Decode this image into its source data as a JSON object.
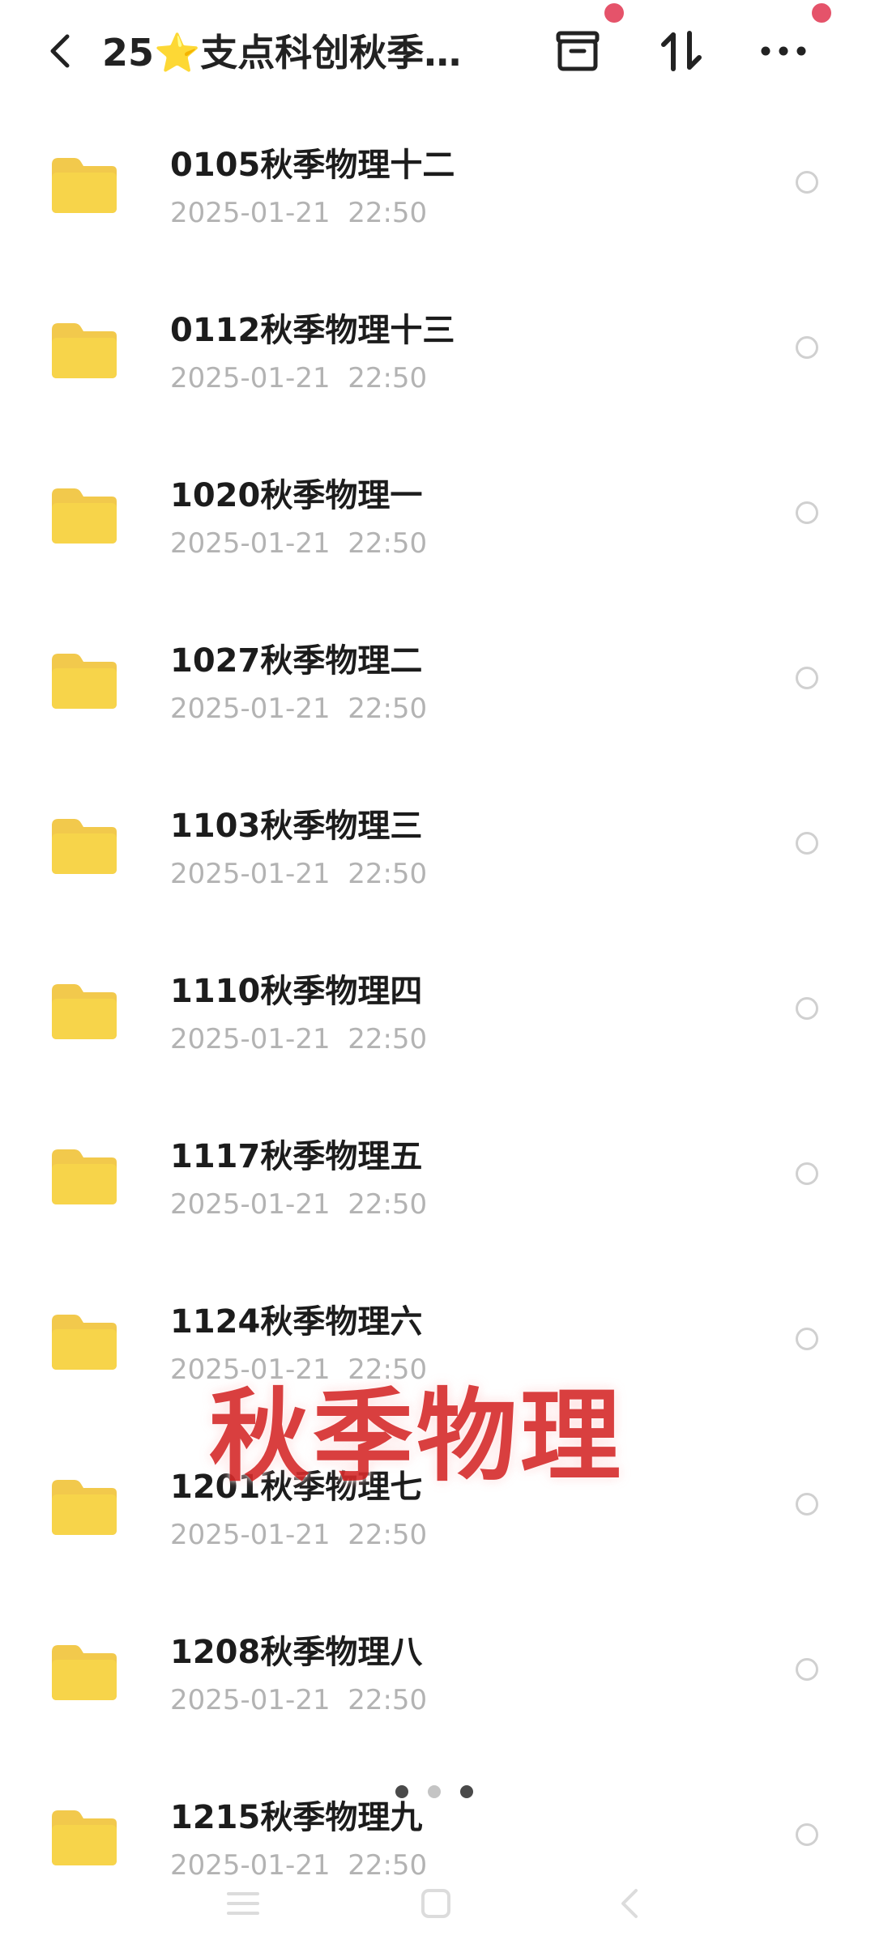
{
  "header": {
    "title": "25⭐支点科创秋季…",
    "back_icon": "chevron-left-icon",
    "actions": [
      {
        "name": "archive-icon",
        "badge": true
      },
      {
        "name": "sort-icon",
        "badge": false
      },
      {
        "name": "more-icon",
        "badge": true
      }
    ]
  },
  "colors": {
    "folder": "#f7d44a",
    "folder_tab": "#f2c94c",
    "badge": "#e5536a",
    "watermark": "#d52b2b",
    "date_text": "#b3b3b3"
  },
  "files": [
    {
      "name": "0105秋季物理十二",
      "date": "2025-01-21  22:50"
    },
    {
      "name": "0112秋季物理十三",
      "date": "2025-01-21  22:50"
    },
    {
      "name": "1020秋季物理一",
      "date": "2025-01-21  22:50"
    },
    {
      "name": "1027秋季物理二",
      "date": "2025-01-21  22:50"
    },
    {
      "name": "1103秋季物理三",
      "date": "2025-01-21  22:50"
    },
    {
      "name": "1110秋季物理四",
      "date": "2025-01-21  22:50"
    },
    {
      "name": "1117秋季物理五",
      "date": "2025-01-21  22:50"
    },
    {
      "name": "1124秋季物理六",
      "date": "2025-01-21  22:50"
    },
    {
      "name": "1201秋季物理七",
      "date": "2025-01-21  22:50"
    },
    {
      "name": "1208秋季物理八",
      "date": "2025-01-21  22:50"
    },
    {
      "name": "1215秋季物理九",
      "date": "2025-01-21  22:50"
    }
  ],
  "watermark": "秋季物理",
  "page_indicator": {
    "count": 3,
    "active": 1
  },
  "navbar": [
    "menu-icon",
    "home-icon",
    "back-icon"
  ]
}
